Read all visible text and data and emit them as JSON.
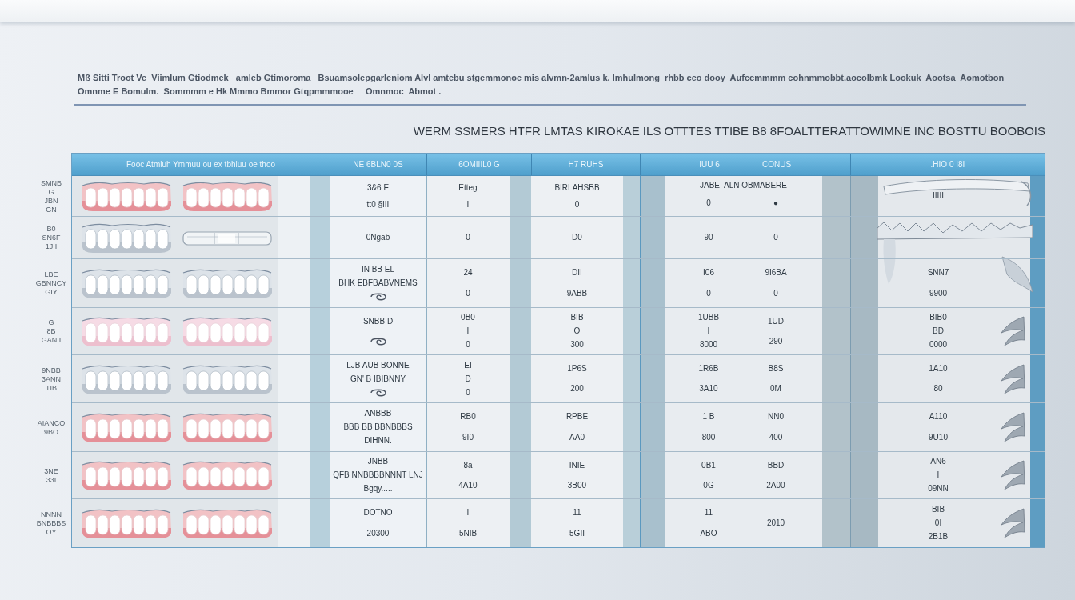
{
  "intro": [
    "Mß Sitti Troot Ve  Viimlum Gtiodmek   amleb Gtimoroma   Bsuamsolepgarleniom Alvl amtebu stgemmonoe mis alvmn-2amlus k. lmhulmong  rhbb ceo dooy  Aufccmmmm cohnmmobbt.aocolbmk Lookuk  Aootsa  Aomotbon",
    "Omnme E Bomulm.  Sommmm e Hk Mmmo Bmmor Gtqpmmmooe     Omnmoc  Abmot ."
  ],
  "title": "WERM SSMERS HTFR LMTAS KIROKAE ILS OTTTES TTIBE B8 8FOALTTERATTOWIMNE INC BOSTTU BOOBOIS",
  "table": {
    "columns": [
      "Fooc Atmiuh Ymmuu ou ex tbhiuu oe thoo",
      "NE 6BLN0 0S",
      "6OMIIIL0 G",
      "H7 RUHS",
      "IUU 6",
      "CONUS",
      ".HIO 0 I8I"
    ],
    "rows": [
      {
        "label": [
          "SMNB",
          "G",
          "JBN",
          "GN"
        ],
        "dentures": [
          {
            "kind": "gum"
          },
          {
            "kind": "gum"
          }
        ],
        "column_2": {
          "kind": "text",
          "lines": [
            "3&6 E",
            "tt0 §III"
          ]
        },
        "column_3": [
          "Etteg",
          "I"
        ],
        "column_4": [
          "BIRLAHSBB",
          "0"
        ],
        "column_5_caption": "JABE  ALN OBMABERE",
        "column_5a": [
          "0"
        ],
        "column_5b": [
          "●"
        ],
        "column_6": {
          "kind": "text",
          "lines": [
            "IIIII"
          ]
        }
      },
      {
        "label": [
          "B0",
          "SN6F",
          "1JII"
        ],
        "dentures": [
          {
            "kind": "plain"
          },
          {
            "kind": "tray"
          }
        ],
        "column_2": {
          "kind": "text",
          "lines": [
            "0Ngab"
          ]
        },
        "column_3": [
          "0"
        ],
        "column_4": [
          "D0"
        ],
        "column_5a": [
          "90"
        ],
        "column_5b": [
          "0"
        ],
        "column_6": {
          "kind": "text"
        }
      },
      {
        "label": [
          "LBE",
          "GBNNCY",
          "GIY"
        ],
        "dentures": [
          {
            "kind": "plain"
          },
          {
            "kind": "plain"
          }
        ],
        "column_2": {
          "kind": "swirl",
          "lines": [
            "IN BB EL",
            "BHK EBFBABVNEMS"
          ]
        },
        "column_3": [
          "24",
          "0"
        ],
        "column_4": [
          "DII",
          "9ABB"
        ],
        "column_5a": [
          "I06",
          "0"
        ],
        "column_5b": [
          "9I6BA",
          "0"
        ],
        "column_6": {
          "kind": "text",
          "lines": [
            "SNN7",
            "9900"
          ]
        }
      },
      {
        "label": [
          "G",
          "8B",
          "GANII"
        ],
        "dentures": [
          {
            "kind": "pale"
          },
          {
            "kind": "pale"
          }
        ],
        "column_2": {
          "kind": "swirl",
          "lines": [
            "SNBB D"
          ]
        },
        "column_3": [
          "0B0",
          "I",
          "0"
        ],
        "column_4": [
          "BIB",
          "O",
          "300"
        ],
        "column_5a": [
          "1UBB",
          "I",
          "8000"
        ],
        "column_5b": [
          "1UD",
          "290"
        ],
        "column_6": {
          "kind": "claw",
          "lines": [
            "BIB0",
            "BD",
            "0000"
          ]
        }
      },
      {
        "label": [
          "9NBB",
          "3ANN",
          "TIB"
        ],
        "dentures": [
          {
            "kind": "plain"
          },
          {
            "kind": "plain"
          }
        ],
        "column_2": {
          "kind": "swirl",
          "lines": [
            "LJB AUB BONNE",
            "GN' B IBIBNNY"
          ]
        },
        "column_3": [
          "EI",
          "D",
          "0"
        ],
        "column_4": [
          "1P6S",
          "200"
        ],
        "column_5a": [
          "1R6B",
          "3A10"
        ],
        "column_5b": [
          "B8S",
          "0M"
        ],
        "column_6": {
          "kind": "claw",
          "lines": [
            "1A10",
            "80"
          ]
        }
      },
      {
        "label": [
          "AIANCO",
          "9BO"
        ],
        "dentures": [
          {
            "kind": "gum"
          },
          {
            "kind": "gum"
          }
        ],
        "column_2": {
          "kind": "text",
          "lines": [
            "ANBBB",
            "BBB BB BBNBBBS",
            "DIHNN."
          ]
        },
        "column_3": [
          "RB0",
          "9I0"
        ],
        "column_4": [
          "RPBE",
          "AA0"
        ],
        "column_5a": [
          "1 B",
          "800"
        ],
        "column_5b": [
          "NN0",
          "400"
        ],
        "column_6": {
          "kind": "claw",
          "lines": [
            "A110",
            "9U10"
          ]
        }
      },
      {
        "label": [
          "3NE",
          "33I"
        ],
        "dentures": [
          {
            "kind": "gum"
          },
          {
            "kind": "gum"
          }
        ],
        "column_2": {
          "kind": "text",
          "lines": [
            "JNBB",
            "QFB NNBBBBNNNT LNJ",
            "Bgqy....."
          ]
        },
        "column_3": [
          "8a",
          "4A10"
        ],
        "column_4": [
          "INIE",
          "3B00"
        ],
        "column_5a": [
          "0B1",
          "0G"
        ],
        "column_5b": [
          "BBD",
          "2A00"
        ],
        "column_6": {
          "kind": "claw",
          "lines": [
            "AN6",
            "I",
            "09NN"
          ]
        }
      },
      {
        "label": [
          "NNNN",
          "BNBBBS",
          "OY"
        ],
        "dentures": [
          {
            "kind": "gum"
          },
          {
            "kind": "gum"
          }
        ],
        "column_2": {
          "kind": "text",
          "lines": [
            "DOTNO",
            "20300"
          ]
        },
        "column_3": [
          "I",
          "5NIB"
        ],
        "column_4": [
          "11",
          "5GII"
        ],
        "column_5a": [
          "11",
          "ABO"
        ],
        "column_5b": [
          "2010"
        ],
        "column_6": {
          "kind": "claw",
          "lines": [
            "BIB",
            "0I",
            "2B1B"
          ]
        }
      }
    ]
  }
}
